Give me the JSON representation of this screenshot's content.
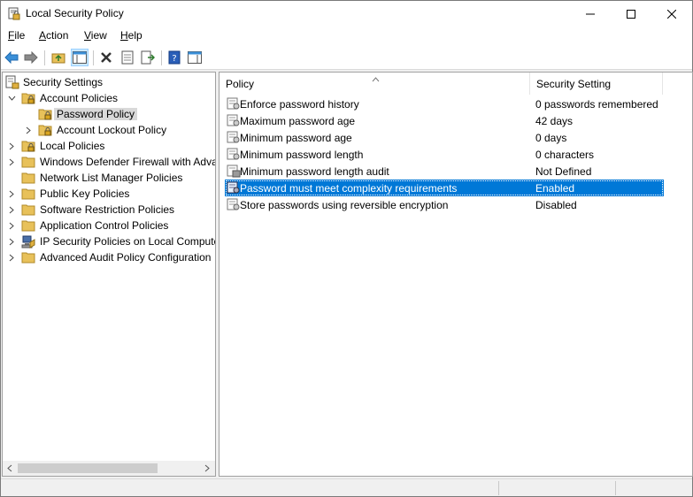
{
  "window": {
    "title": "Local Security Policy"
  },
  "menu": [
    {
      "label": "File",
      "accel": "F",
      "rest": "ile"
    },
    {
      "label": "Action",
      "accel": "A",
      "rest": "ction"
    },
    {
      "label": "View",
      "accel": "V",
      "rest": "iew"
    },
    {
      "label": "Help",
      "accel": "H",
      "rest": "elp"
    }
  ],
  "tree": {
    "items": [
      {
        "label": "Security Settings",
        "icon": "security-settings-icon"
      },
      {
        "label": "Account Policies",
        "icon": "folder-lock-icon"
      },
      {
        "label": "Password Policy",
        "icon": "folder-lock-icon"
      },
      {
        "label": "Account Lockout Policy",
        "icon": "folder-lock-icon"
      },
      {
        "label": "Local Policies",
        "icon": "folder-lock-icon"
      },
      {
        "label": "Windows Defender Firewall with Adva",
        "icon": "folder-icon"
      },
      {
        "label": "Network List Manager Policies",
        "icon": "folder-icon"
      },
      {
        "label": "Public Key Policies",
        "icon": "folder-icon"
      },
      {
        "label": "Software Restriction Policies",
        "icon": "folder-icon"
      },
      {
        "label": "Application Control Policies",
        "icon": "folder-icon"
      },
      {
        "label": "IP Security Policies on Local Compute",
        "icon": "ip-security-icon"
      },
      {
        "label": "Advanced Audit Policy Configuration",
        "icon": "folder-icon"
      }
    ]
  },
  "list": {
    "columns": {
      "policy": "Policy",
      "setting": "Security Setting"
    },
    "rows": [
      {
        "policy": "Enforce password history",
        "setting": "0 passwords remembered"
      },
      {
        "policy": "Maximum password age",
        "setting": "42 days"
      },
      {
        "policy": "Minimum password age",
        "setting": "0 days"
      },
      {
        "policy": "Minimum password length",
        "setting": "0 characters"
      },
      {
        "policy": "Minimum password length audit",
        "setting": "Not Defined"
      },
      {
        "policy": "Password must meet complexity requirements",
        "setting": "Enabled"
      },
      {
        "policy": "Store passwords using reversible encryption",
        "setting": "Disabled"
      }
    ]
  },
  "colors": {
    "selection": "#0078d7",
    "tree_selection": "#d9d9d9",
    "folder": "#e8c15a"
  }
}
